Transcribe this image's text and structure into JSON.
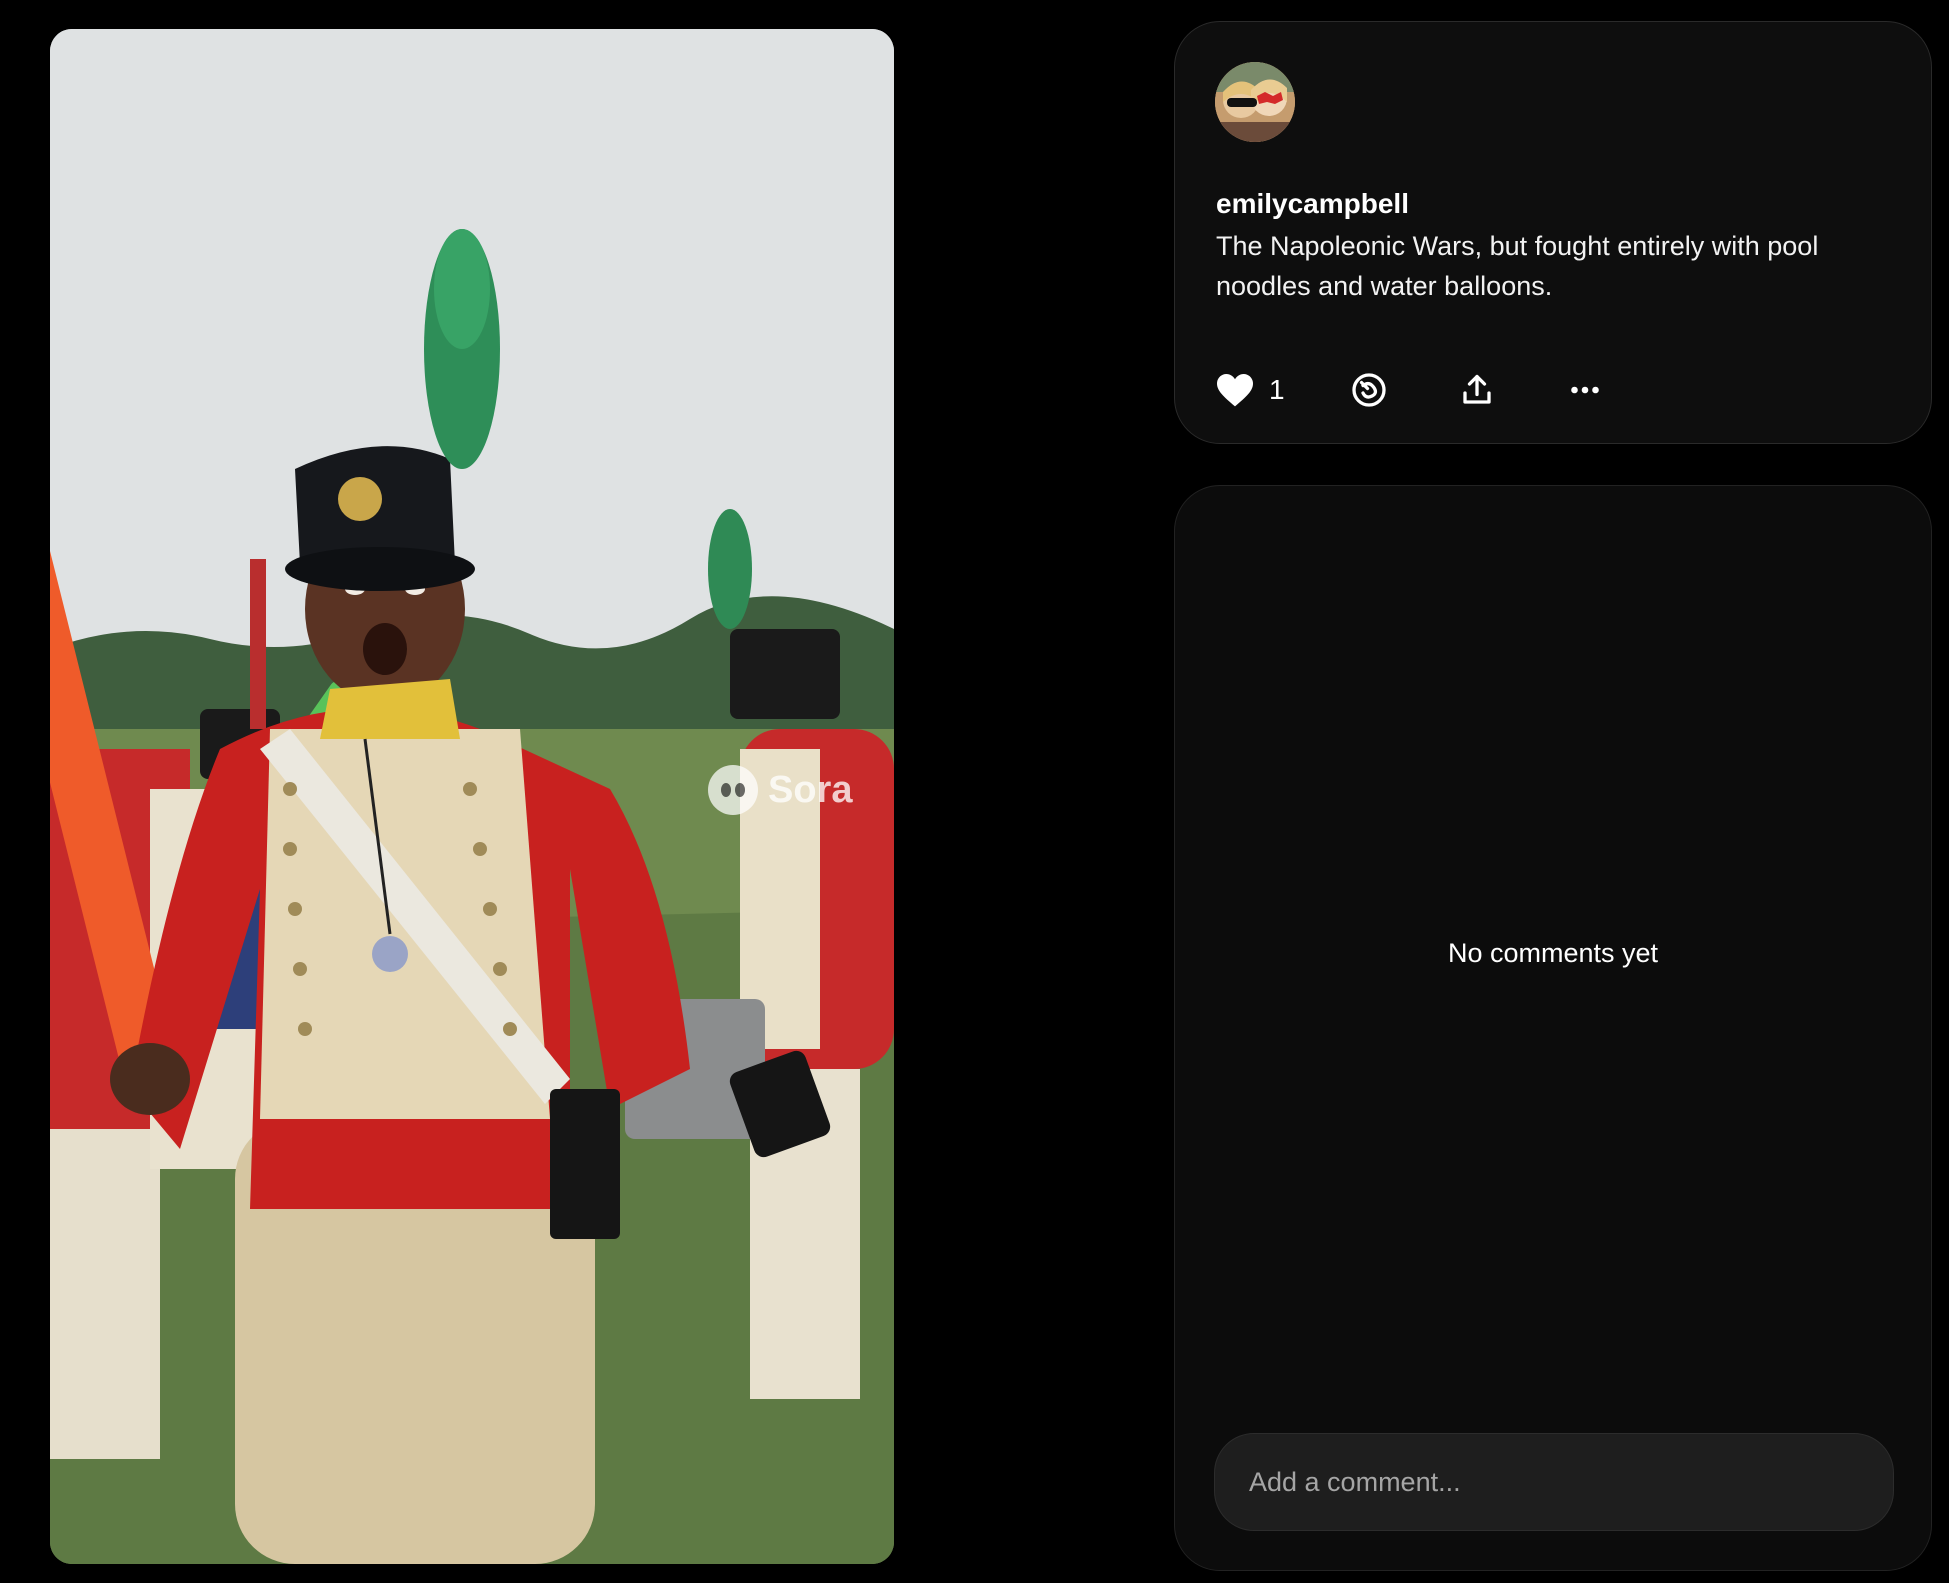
{
  "video": {
    "watermark_text": "Sora",
    "watermark_icon": "sora-logo-icon"
  },
  "post": {
    "avatar_icon": "user-avatar",
    "username": "emilycampbell",
    "caption": "The Napoleonic Wars, but fought entirely with pool noodles and water balloons.",
    "actions": {
      "like_icon": "heart-icon",
      "like_count": "1",
      "remix_icon": "remix-icon",
      "share_icon": "share-upload-icon",
      "more_icon": "more-dots-icon"
    }
  },
  "comments": {
    "empty_text": "No comments yet",
    "input_placeholder": "Add a comment..."
  },
  "colors": {
    "background": "#000000",
    "card": "#0e0e0e",
    "input": "#1e1e1e",
    "text": "#ffffff",
    "placeholder": "#a5a5a5"
  }
}
